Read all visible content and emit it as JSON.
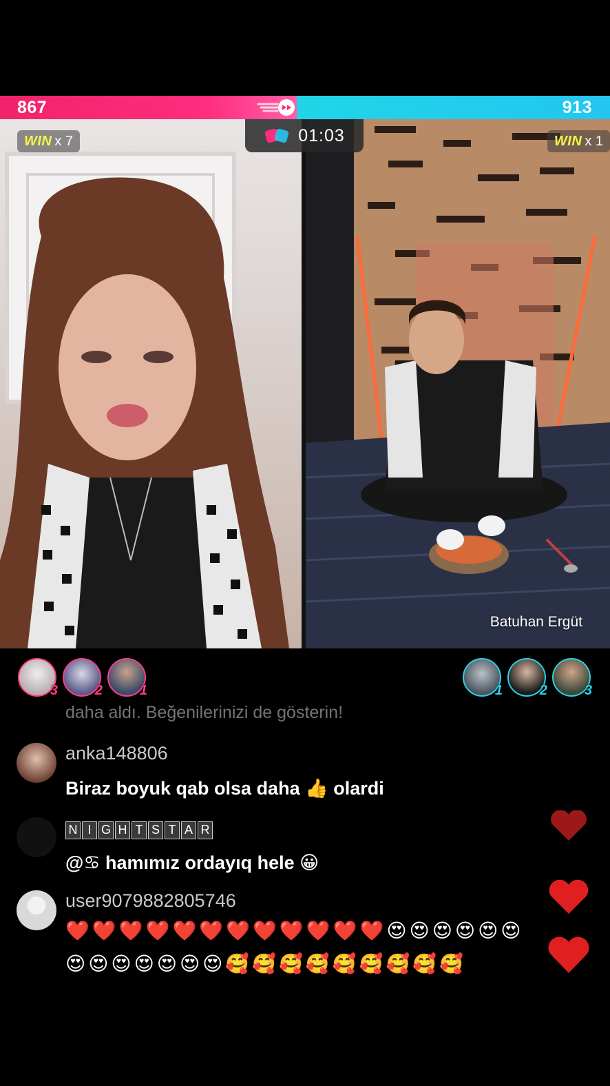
{
  "battle": {
    "left_score": "867",
    "right_score": "913",
    "left_fraction": 0.487,
    "timer": "01:03",
    "left_win_word": "WIN",
    "left_win_count": "x 7",
    "right_win_word": "WIN",
    "right_win_count": "x 1"
  },
  "right_host_name": "Batuhan Ergüt",
  "supporters_left": [
    {
      "rank": "3"
    },
    {
      "rank": "2"
    },
    {
      "rank": "1"
    }
  ],
  "supporters_right": [
    {
      "rank": "1"
    },
    {
      "rank": "2"
    },
    {
      "rank": "3"
    }
  ],
  "chat": {
    "faded_line": "daha aldı. Beğenilerinizi de gösterin!",
    "messages": [
      {
        "user": "anka148806",
        "text": "Biraz boyuk qab olsa daha 👍 olardi"
      },
      {
        "user_letters": [
          "N",
          "I",
          "G",
          "H",
          "T",
          "S",
          "T",
          "A",
          "R"
        ],
        "text": "@♋ hamımız ordayıq hele 😀"
      },
      {
        "user": "user9079882805746",
        "line1": "❤️❤️❤️❤️❤️❤️❤️❤️❤️❤️❤️❤️😍😍😍😍😍😍",
        "line2": "😍😍😍😍😍😍😍🥰🥰🥰🥰🥰🥰🥰🥰🥰"
      }
    ]
  },
  "colors": {
    "left_team": "#ff2d7e",
    "right_team": "#23c6f0",
    "win_yellow": "#f5f54a",
    "heart_red": "#e02020"
  }
}
